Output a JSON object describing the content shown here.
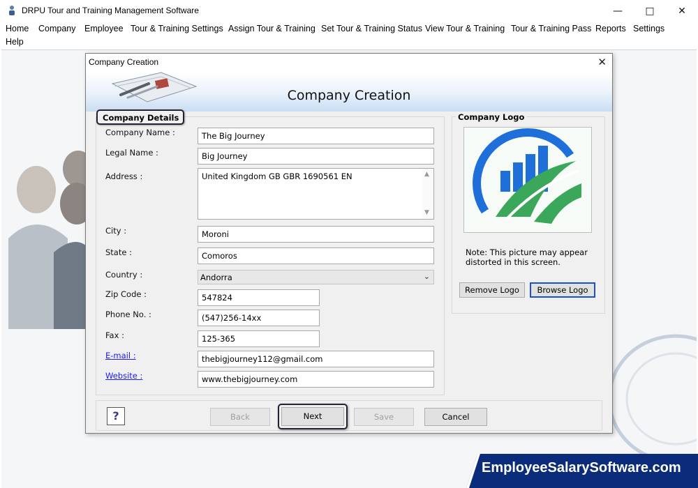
{
  "window": {
    "title": "DRPU Tour and Training Management Software"
  },
  "menu": [
    "Home",
    "Company",
    "Employee",
    "Tour & Training Settings",
    "Assign Tour & Training",
    "Set Tour & Training Status",
    "View Tour & Training",
    "Tour & Training Pass",
    "Reports",
    "Settings",
    "Help"
  ],
  "dialog": {
    "title": "Company Creation",
    "banner_title": "Company Creation",
    "details_legend": "Company Details",
    "logo_legend": "Company Logo",
    "labels": {
      "company_name": "Company Name :",
      "legal_name": "Legal Name :",
      "address": "Address :",
      "city": "City :",
      "state": "State :",
      "country": "Country :",
      "zip": "Zip Code :",
      "phone": "Phone No. :",
      "fax": "Fax :",
      "email": "E-mail :",
      "website": "Website :"
    },
    "values": {
      "company_name": "The Big Journey",
      "legal_name": "Big Journey",
      "address": "United Kingdom GB GBR 1690561 EN",
      "city": "Moroni",
      "state": "Comoros",
      "country": "Andorra",
      "zip": "547824",
      "phone": "(547)256-14xx",
      "fax": "125-365",
      "email": "thebigjourney112@gmail.com",
      "website": "www.thebigjourney.com"
    },
    "note": "Note: This picture may appear distorted in this screen.",
    "buttons": {
      "remove_logo": "Remove Logo",
      "browse_logo": "Browse Logo",
      "help": "?",
      "back": "Back",
      "next": "Next",
      "save": "Save",
      "cancel": "Cancel"
    }
  },
  "watermark": "EmployeeSalarySoftware.com",
  "colors": {
    "link": "#1a1aff",
    "focus": "#1a4fd0",
    "banner_bg": "#0b2c7a",
    "logo_blue": "#1e6fd9",
    "logo_green": "#3aa75a"
  }
}
